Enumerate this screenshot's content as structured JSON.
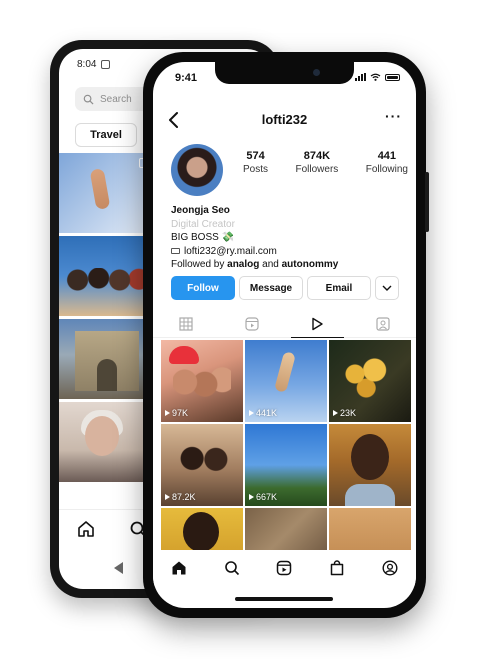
{
  "back_phone": {
    "status_time": "8:04",
    "search_placeholder": "Search",
    "chip_label": "Travel"
  },
  "front_phone": {
    "status_time": "9:41",
    "profile": {
      "username": "lofti232",
      "more_label": "···",
      "stats": [
        {
          "value": "574",
          "label": "Posts"
        },
        {
          "value": "874K",
          "label": "Followers"
        },
        {
          "value": "441",
          "label": "Following"
        }
      ],
      "name": "Jeongja Seo",
      "category": "Digital Creator",
      "bio_line": "BIG BOSS 💸",
      "email": "lofti232@ry.mail.com",
      "followed_by_prefix": "Followed by ",
      "followed_by_1": "analog",
      "followed_by_and": " and ",
      "followed_by_2": "autonommy"
    },
    "actions": {
      "follow": "Follow",
      "message": "Message",
      "email": "Email"
    },
    "tabs": [
      "grid-icon",
      "reels-icon",
      "play-icon",
      "tagged-icon"
    ],
    "active_tab": "play-icon",
    "grid_views": [
      "97K",
      "441K",
      "23K",
      "87.2K",
      "667K",
      ""
    ],
    "bottom_nav": [
      "home-icon",
      "search-icon",
      "reels-icon",
      "shop-icon",
      "profile-icon"
    ],
    "colors": {
      "follow_button": "#2795ef",
      "category_text": "#c5c5c5"
    }
  }
}
